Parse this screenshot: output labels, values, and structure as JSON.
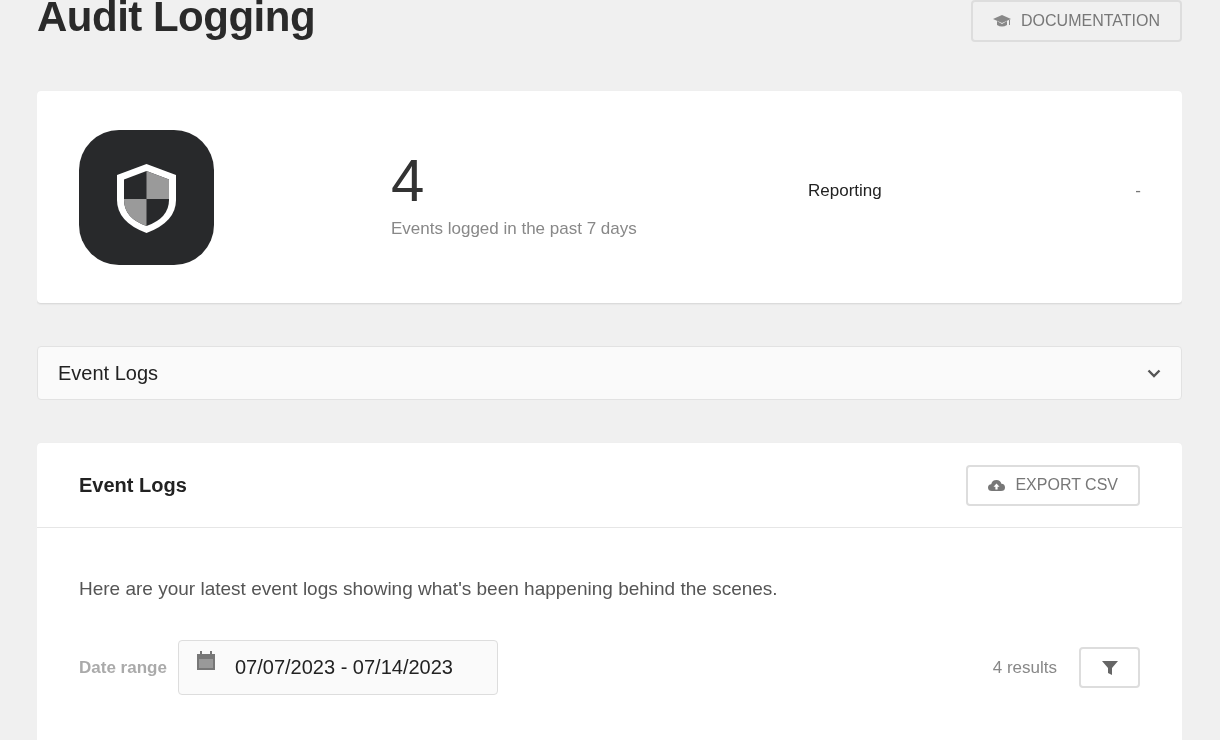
{
  "page_title": "Audit Logging",
  "documentation_button": "DOCUMENTATION",
  "summary": {
    "count": "4",
    "caption": "Events logged in the past 7 days",
    "stats": [
      {
        "label": "Reporting",
        "value": "-"
      }
    ]
  },
  "accordion": {
    "title": "Event Logs",
    "expanded": false
  },
  "event_logs": {
    "title": "Event Logs",
    "export_button": "EXPORT CSV",
    "description": "Here are your latest event logs showing what's been happening behind the scenes.",
    "date_range_label": "Date range",
    "date_range": "07/07/2023 - 07/14/2023",
    "results": "4 results"
  }
}
